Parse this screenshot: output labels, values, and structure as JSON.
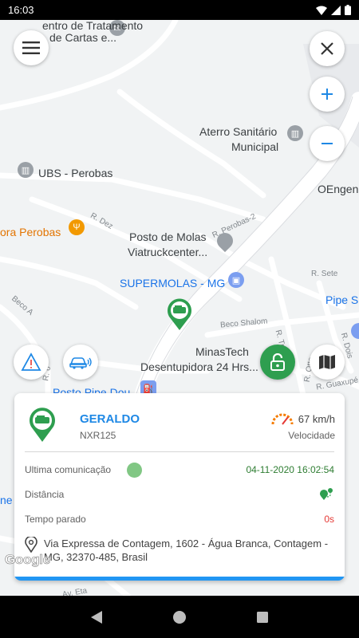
{
  "status_bar": {
    "time": "16:03",
    "icons": [
      "wifi-icon",
      "signal-icon",
      "battery-icon"
    ]
  },
  "map": {
    "labels": {
      "centro": "entro de Tratamento",
      "cartas": "de Cartas e...",
      "aterro1": "Aterro Sanitário",
      "aterro2": "Municipal",
      "ubs": "UBS - Perobas",
      "oengen": "OEngen",
      "r_dez": "R. Dez",
      "ora_perobas": "ora Perobas",
      "posto1": "Posto de Molas",
      "posto2": "Viatruckcenter...",
      "r_perobas2": "R. Perobas-2",
      "supermolas": "SUPERMOLAS - MG",
      "r_sete": "R. Sete",
      "pipe": "Pipe S",
      "beco_a": "Beco A",
      "beco_shalom": "Beco Shalom",
      "minastech1": "MinasTech",
      "minastech2": "Desentupidora 24 Hrs...",
      "r_tres": "R. Três",
      "r_otto": "R. Otto",
      "r_dois": "R. Dois",
      "r_guaxupe": "R. Guaxupé",
      "posto_pipe": "Posto Pipe Dou",
      "r_6": "R. 6",
      "av_eta": "Av. Eta",
      "ne": "ne"
    },
    "google_logo": "Google"
  },
  "controls": {
    "menu_icon": "hamburger-menu-icon",
    "close_icon": "close-icon",
    "zoom_in_icon": "plus-icon",
    "zoom_out_icon": "minus-icon",
    "alert_icon": "warning-icon",
    "vehicle_icon": "car-signal-icon",
    "lock_icon": "unlock-icon",
    "map_icon": "map-icon"
  },
  "vehicle_card": {
    "name": "GERALDO",
    "plate": "NXR125",
    "speed": "67 km/h",
    "speed_label": "Velocidade",
    "last_comm_label": "Ultima comunicação",
    "last_comm_value": "04-11-2020 16:02:54",
    "distance_label": "Distância",
    "stopped_label": "Tempo parado",
    "stopped_value": "0s",
    "address": "Via Expressa de Contagem, 1602 - Água Branca, Contagem - MG, 32370-485, Brasil"
  },
  "colors": {
    "accent_blue": "#1e88e5",
    "status_green": "#2e9e4f",
    "value_green": "#2e7d32",
    "value_red": "#e53935",
    "speed_orange": "#f57c00"
  }
}
